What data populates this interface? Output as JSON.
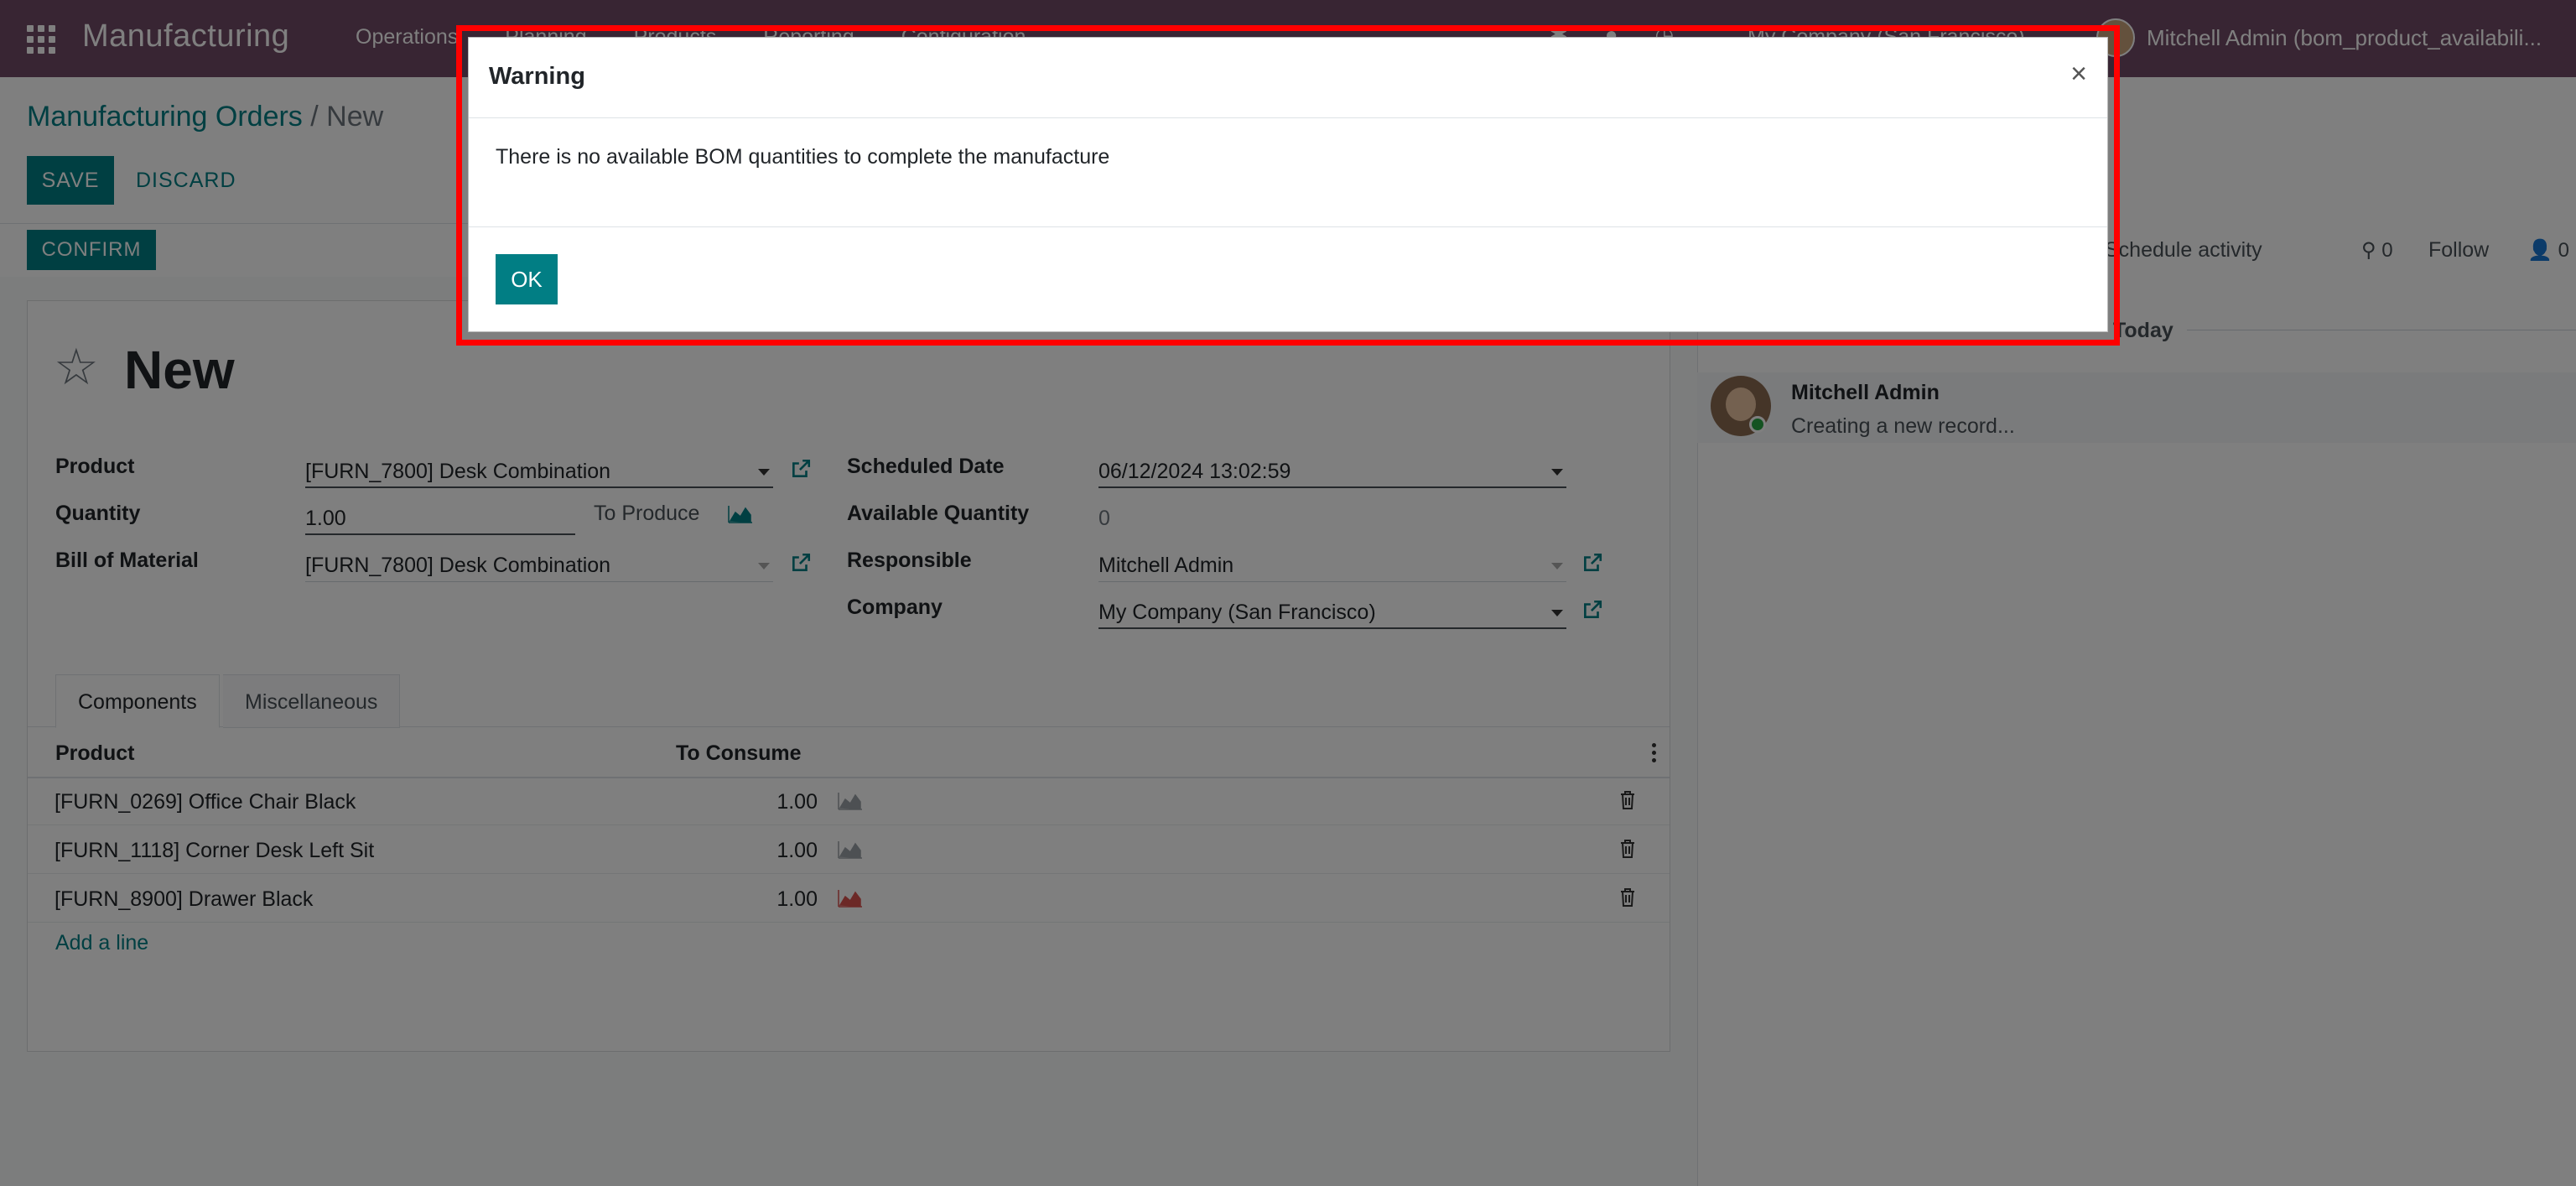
{
  "navbar": {
    "app_name": "Manufacturing",
    "menu": [
      "Operations",
      "Planning",
      "Products",
      "Reporting",
      "Configuration"
    ],
    "company": "My Company (San Francisco)",
    "user": "Mitchell Admin (bom_product_availabili..."
  },
  "breadcrumb": {
    "parent": "Manufacturing Orders",
    "separator": "/",
    "current": "New"
  },
  "buttons": {
    "save": "SAVE",
    "discard": "DISCARD",
    "confirm": "CONFIRM"
  },
  "form": {
    "title": "New",
    "labels": {
      "product": "Product",
      "quantity": "Quantity",
      "bom": "Bill of Material",
      "scheduled_date": "Scheduled Date",
      "available_qty": "Available Quantity",
      "responsible": "Responsible",
      "company": "Company",
      "to_produce": "To Produce"
    },
    "values": {
      "product": "[FURN_7800] Desk Combination",
      "quantity": "1.00",
      "bom": "[FURN_7800] Desk Combination",
      "scheduled_date": "06/12/2024 13:02:59",
      "available_qty": "0",
      "responsible": "Mitchell Admin",
      "company": "My Company (San Francisco)"
    }
  },
  "tabs": [
    "Components",
    "Miscellaneous"
  ],
  "components": {
    "headers": {
      "product": "Product",
      "to_consume": "To Consume"
    },
    "rows": [
      {
        "product": "[FURN_0269] Office Chair Black",
        "qty": "1.00",
        "chart_color": "#9aa0a6"
      },
      {
        "product": "[FURN_1118] Corner Desk Left Sit",
        "qty": "1.00",
        "chart_color": "#9aa0a6"
      },
      {
        "product": "[FURN_8900] Drawer Black",
        "qty": "1.00",
        "chart_color": "#d9534f"
      }
    ],
    "add_line": "Add a line"
  },
  "chatter": {
    "activity": "Schedule activity",
    "attachments": "0",
    "follow": "Follow",
    "followers": "0",
    "today": "Today",
    "message_author": "Mitchell Admin",
    "message_body": "Creating a new record..."
  },
  "dialog": {
    "title": "Warning",
    "close": "×",
    "message": "There is no available BOM quantities to complete the manufacture",
    "ok": "OK"
  },
  "colors": {
    "brand": "#714b67",
    "accent": "#017e84",
    "highlight": "#ff0000"
  }
}
